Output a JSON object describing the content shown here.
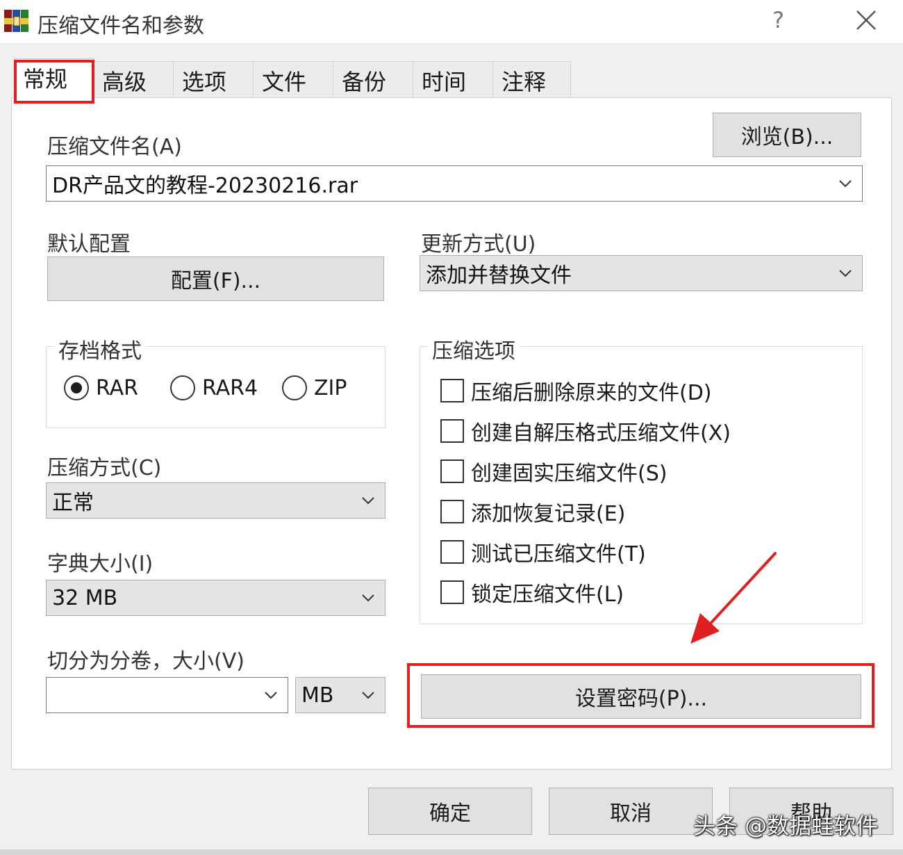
{
  "window": {
    "title": "压缩文件名和参数",
    "help_glyph": "?",
    "icon": "winrar-books-icon"
  },
  "tabs": [
    {
      "label": "常规",
      "active": true
    },
    {
      "label": "高级",
      "active": false
    },
    {
      "label": "选项",
      "active": false
    },
    {
      "label": "文件",
      "active": false
    },
    {
      "label": "备份",
      "active": false
    },
    {
      "label": "时间",
      "active": false
    },
    {
      "label": "注释",
      "active": false
    }
  ],
  "general": {
    "archive_name_label": "压缩文件名(A)",
    "archive_name_value": "DR产品文的教程-20230216.rar",
    "browse_label": "浏览(B)...",
    "profile_label": "默认配置",
    "profile_button": "配置(F)...",
    "update_mode_label": "更新方式(U)",
    "update_mode_value": "添加并替换文件",
    "format_group_title": "存档格式",
    "formats": [
      {
        "label": "RAR",
        "selected": true
      },
      {
        "label": "RAR4",
        "selected": false
      },
      {
        "label": "ZIP",
        "selected": false
      }
    ],
    "method_label": "压缩方式(C)",
    "method_value": "正常",
    "dict_label": "字典大小(I)",
    "dict_value": "32 MB",
    "split_label": "切分为分卷，大小(V)",
    "split_value": "",
    "split_unit": "MB",
    "options_group_title": "压缩选项",
    "options": [
      {
        "label": "压缩后删除原来的文件(D)",
        "checked": false
      },
      {
        "label": "创建自解压格式压缩文件(X)",
        "checked": false
      },
      {
        "label": "创建固实压缩文件(S)",
        "checked": false
      },
      {
        "label": "添加恢复记录(E)",
        "checked": false
      },
      {
        "label": "测试已压缩文件(T)",
        "checked": false
      },
      {
        "label": "锁定压缩文件(L)",
        "checked": false
      }
    ],
    "password_button": "设置密码(P)..."
  },
  "footer": {
    "ok": "确定",
    "cancel": "取消",
    "help": "帮助"
  },
  "watermark": "头条 @数据蛙软件",
  "colors": {
    "highlight": "#e02020",
    "button_face": "#e1e1e1",
    "panel": "#ffffff",
    "window_bg": "#f0f0f0"
  }
}
